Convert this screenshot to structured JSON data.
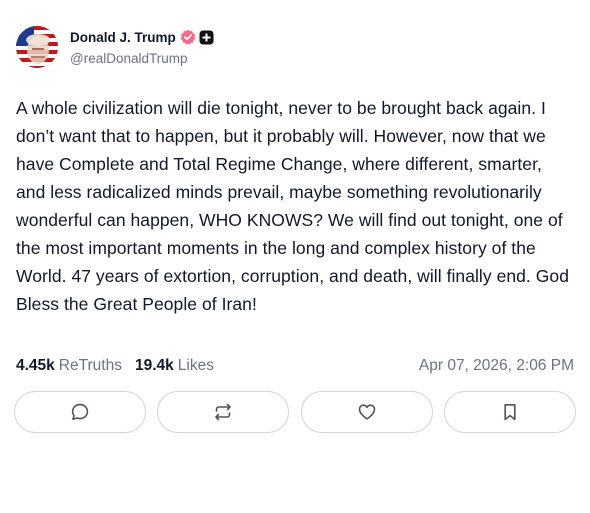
{
  "author": {
    "display_name": "Donald J. Trump",
    "handle": "@realDonaldTrump",
    "avatar_icon": "avatar-flag-portrait",
    "verified_icon": "verified-badge-icon",
    "badge_icon": "plus-badge-icon",
    "verified_color": "#f06b8a"
  },
  "post": {
    "text": "A whole civilization will die tonight, never to be brought back again. I don’t want that to happen, but it probably will. However, now that we have Complete and Total Regime Change, where different, smarter, and less radicalized minds prevail, maybe something revolutionarily wonderful can happen, WHO KNOWS? We will find out tonight, one of the most important moments in the long and complex history of the World. 47 years of extortion, corruption, and death, will finally end. God Bless the Great People of Iran!"
  },
  "stats": {
    "retruths_count": "4.45k",
    "retruths_label": "ReTruths",
    "likes_count": "19.4k",
    "likes_label": "Likes",
    "timestamp": "Apr 07, 2026, 2:06 PM"
  },
  "actions": [
    {
      "name": "reply",
      "icon": "comment-icon"
    },
    {
      "name": "retruth",
      "icon": "repost-icon"
    },
    {
      "name": "like",
      "icon": "heart-icon"
    },
    {
      "name": "bookmark",
      "icon": "bookmark-icon"
    }
  ]
}
